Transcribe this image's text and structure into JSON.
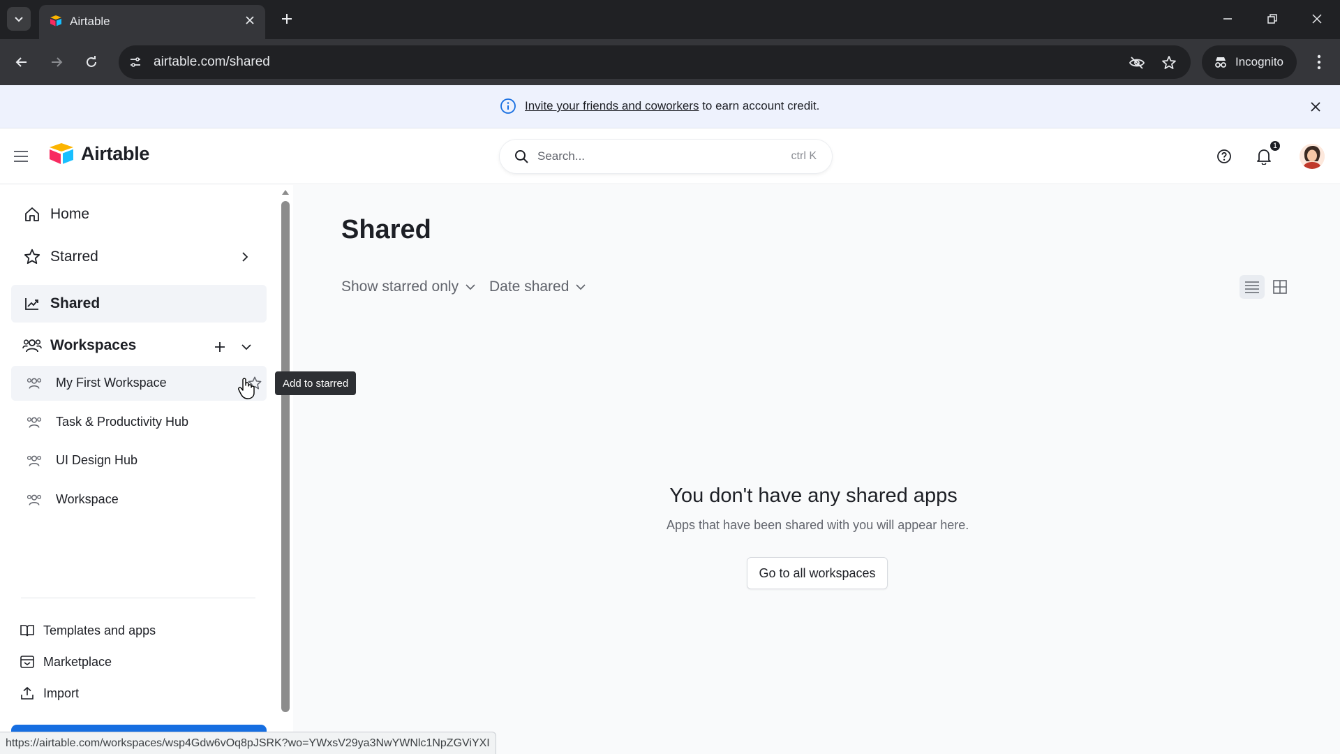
{
  "browser": {
    "tab_title": "Airtable",
    "url": "airtable.com/shared",
    "incognito_label": "Incognito",
    "status_url": "https://airtable.com/workspaces/wsp4Gdw6vOq8pJSRK?wo=YWxsV29ya3NwYWNlc1NpZGViYXI"
  },
  "banner": {
    "link_text": "Invite your friends and coworkers",
    "rest_text": "to earn account credit."
  },
  "header": {
    "logo_text": "Airtable",
    "search_placeholder": "Search...",
    "search_shortcut": "ctrl K",
    "notification_count": "1"
  },
  "sidebar": {
    "nav": [
      {
        "label": "Home",
        "icon": "home-icon"
      },
      {
        "label": "Starred",
        "icon": "star-icon"
      },
      {
        "label": "Shared",
        "icon": "shared-icon"
      },
      {
        "label": "Workspaces",
        "icon": "workspaces-icon"
      }
    ],
    "workspaces": [
      {
        "label": "My First Workspace"
      },
      {
        "label": "Task & Productivity Hub"
      },
      {
        "label": "UI Design Hub"
      },
      {
        "label": "Workspace"
      }
    ],
    "footer_links": [
      {
        "label": "Templates and apps",
        "icon": "book-icon"
      },
      {
        "label": "Marketplace",
        "icon": "marketplace-icon"
      },
      {
        "label": "Import",
        "icon": "import-icon"
      }
    ]
  },
  "tooltip": {
    "text": "Add to starred"
  },
  "main": {
    "title": "Shared",
    "filters": {
      "starred": "Show starred only",
      "sort": "Date shared"
    },
    "empty_title": "You don't have any shared apps",
    "empty_subtitle": "Apps that have been shared with you will appear here.",
    "go_button": "Go to all workspaces"
  },
  "colors": {
    "accent": "#166ee1",
    "banner_bg": "#eef2fd",
    "chrome_dark": "#202124"
  }
}
